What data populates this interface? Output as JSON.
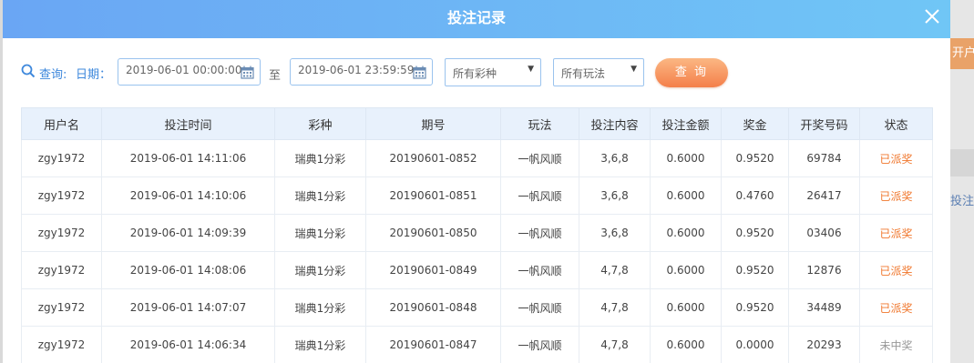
{
  "background": {
    "orange_fragment": "开户",
    "blue_fragment": "投注记"
  },
  "modal": {
    "title": "投注记录"
  },
  "filter": {
    "query_label": "查询:",
    "date_label": "日期：",
    "start_date": "2019-06-01 00:00:00",
    "to_label": "至",
    "end_date": "2019-06-01 23:59:59",
    "lottery_select": "所有彩种",
    "play_select": "所有玩法",
    "query_button": "查 询"
  },
  "table": {
    "headers": [
      "用户名",
      "投注时间",
      "彩种",
      "期号",
      "玩法",
      "投注内容",
      "投注金额",
      "奖金",
      "开奖号码",
      "状态"
    ],
    "rows": [
      [
        "zgy1972",
        "2019-06-01 14:11:06",
        "瑞典1分彩",
        "20190601-0852",
        "一帆风顺",
        "3,6,8",
        "0.6000",
        "0.9520",
        "69784",
        "已派奖"
      ],
      [
        "zgy1972",
        "2019-06-01 14:10:06",
        "瑞典1分彩",
        "20190601-0851",
        "一帆风顺",
        "3,6,8",
        "0.6000",
        "0.4760",
        "26417",
        "已派奖"
      ],
      [
        "zgy1972",
        "2019-06-01 14:09:39",
        "瑞典1分彩",
        "20190601-0850",
        "一帆风顺",
        "3,6,8",
        "0.6000",
        "0.9520",
        "03406",
        "已派奖"
      ],
      [
        "zgy1972",
        "2019-06-01 14:08:06",
        "瑞典1分彩",
        "20190601-0849",
        "一帆风顺",
        "4,7,8",
        "0.6000",
        "0.9520",
        "12876",
        "已派奖"
      ],
      [
        "zgy1972",
        "2019-06-01 14:07:07",
        "瑞典1分彩",
        "20190601-0848",
        "一帆风顺",
        "4,7,8",
        "0.6000",
        "0.9520",
        "34489",
        "已派奖"
      ],
      [
        "zgy1972",
        "2019-06-01 14:06:34",
        "瑞典1分彩",
        "20190601-0847",
        "一帆风顺",
        "4,7,8",
        "0.6000",
        "0.0000",
        "20293",
        "未中奖"
      ]
    ]
  },
  "colors": {
    "header_gradient_start": "#6aa6f4",
    "header_gradient_end": "#70c6f6",
    "label_blue": "#3e88dc",
    "status_won": "#f0772d",
    "status_lost": "#999999",
    "button_orange": "#f47f4a"
  }
}
